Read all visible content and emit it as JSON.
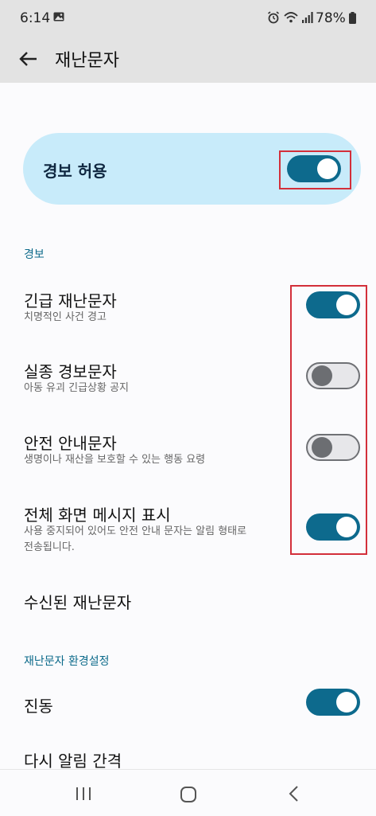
{
  "status_bar": {
    "time": "6:14",
    "battery": "78%"
  },
  "app_bar": {
    "title": "재난문자",
    "back_icon": "arrow-left-icon"
  },
  "master_toggle": {
    "label": "경보 허용",
    "on": true
  },
  "alerts_section": {
    "header": "경보",
    "items": [
      {
        "title": "긴급 재난문자",
        "subtitle": "치명적인 사건 경고",
        "on": true
      },
      {
        "title": "실종 경보문자",
        "subtitle": "아동 유괴 긴급상황 공지",
        "on": false
      },
      {
        "title": "안전 안내문자",
        "subtitle": "생명이나 재산을 보호할 수 있는 행동 요령",
        "on": false
      },
      {
        "title": "전체 화면 메시지 표시",
        "subtitle": "사용 중지되어 있어도 안전 안내 문자는 알림 형태로 전송됩니다.",
        "on": true
      }
    ]
  },
  "received_item": {
    "title": "수신된 재난문자"
  },
  "preferences_section": {
    "header": "재난문자 환경설정",
    "vibration": {
      "title": "진동",
      "on": true
    },
    "repeat_interval": {
      "title": "다시 알림 간격"
    }
  },
  "colors": {
    "accent": "#0d6a8d",
    "master_card": "#c8ebfa",
    "highlight": "#d32f3a"
  },
  "nav_bar": {
    "icons": [
      "recent-apps-icon",
      "home-icon",
      "back-icon"
    ]
  }
}
